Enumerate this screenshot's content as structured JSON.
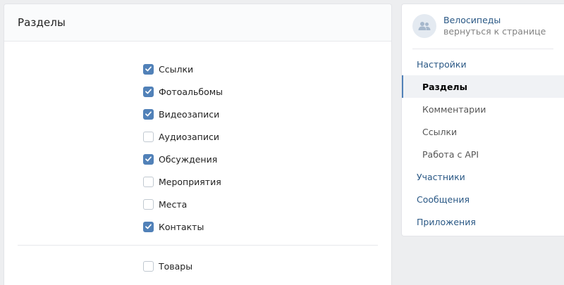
{
  "sections": {
    "title": "Разделы",
    "items": [
      {
        "label": "Ссылки",
        "checked": true
      },
      {
        "label": "Фотоальбомы",
        "checked": true
      },
      {
        "label": "Видеозаписи",
        "checked": true
      },
      {
        "label": "Аудиозаписи",
        "checked": false
      },
      {
        "label": "Обсуждения",
        "checked": true
      },
      {
        "label": "Мероприятия",
        "checked": false
      },
      {
        "label": "Места",
        "checked": false
      },
      {
        "label": "Контакты",
        "checked": true
      }
    ],
    "goods": {
      "label": "Товары",
      "checked": false
    }
  },
  "sidebar": {
    "group_name": "Велосипеды",
    "back_link": "вернуться к странице",
    "avatar_icon": "community-icon",
    "menu": [
      {
        "label": "Настройки",
        "level": 0,
        "active": false
      },
      {
        "label": "Разделы",
        "level": 1,
        "active": true
      },
      {
        "label": "Комментарии",
        "level": 1,
        "active": false
      },
      {
        "label": "Ссылки",
        "level": 1,
        "active": false
      },
      {
        "label": "Работа с API",
        "level": 1,
        "active": false
      },
      {
        "label": "Участники",
        "level": 0,
        "active": false
      },
      {
        "label": "Сообщения",
        "level": 0,
        "active": false
      },
      {
        "label": "Приложения",
        "level": 0,
        "active": false
      }
    ]
  },
  "colors": {
    "accent": "#5181b8",
    "link": "#2a5885",
    "background": "#edeef0"
  }
}
